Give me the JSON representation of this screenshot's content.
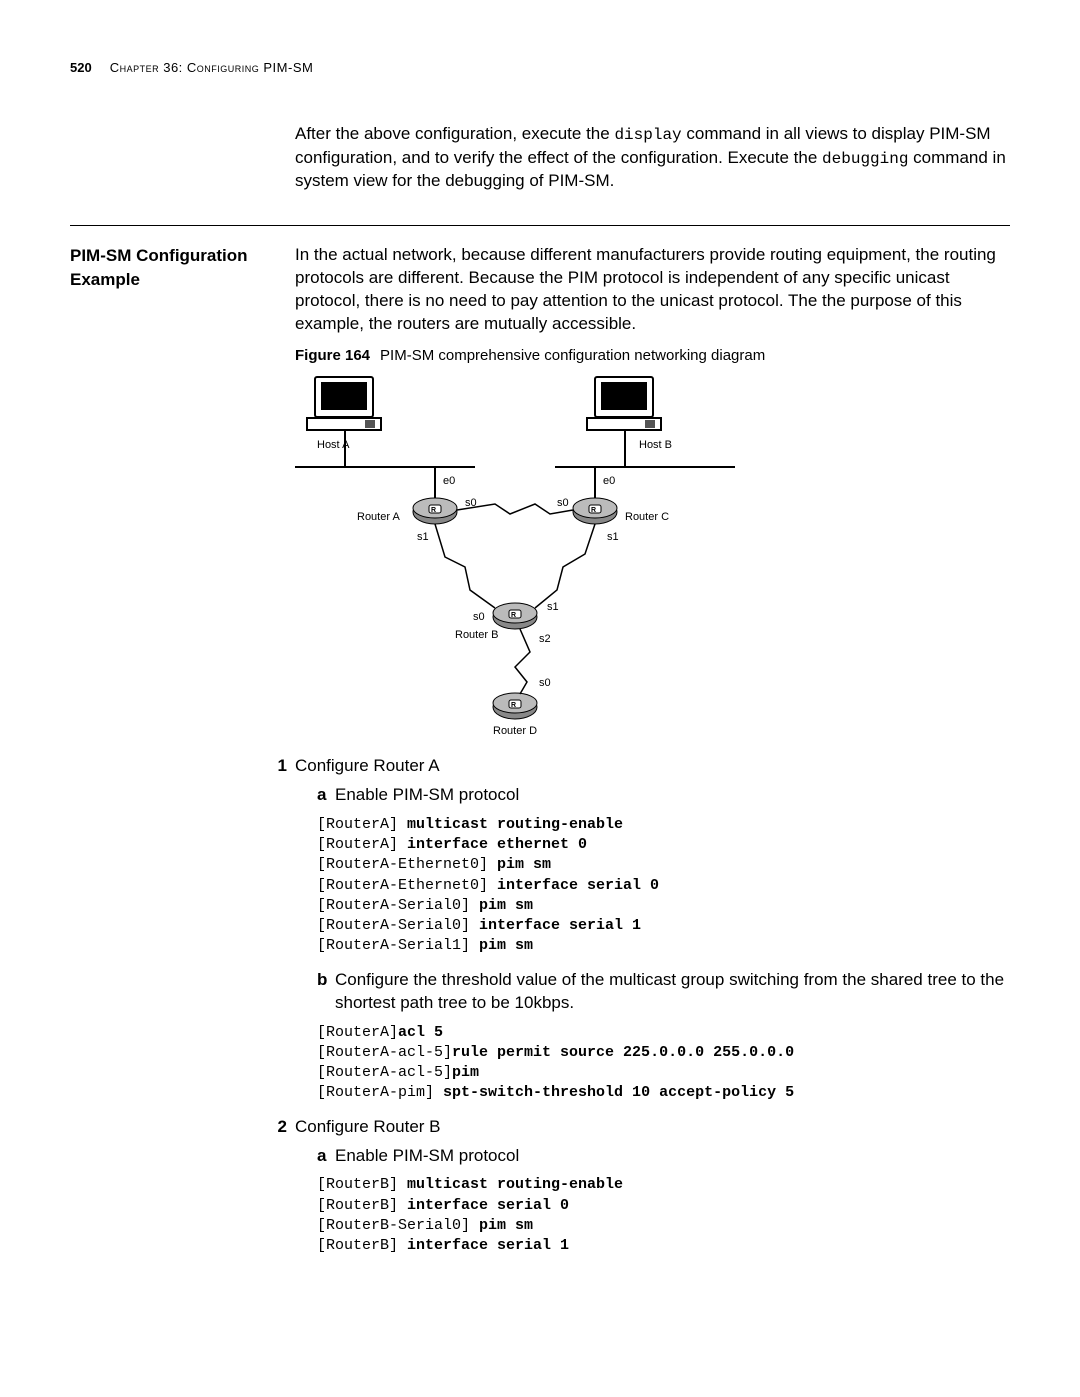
{
  "header": {
    "page_number": "520",
    "chapter_line": "Chapter 36: Configuring PIM-SM"
  },
  "intro_para": {
    "t1a": "After the above configuration, execute the ",
    "code1": "display",
    "t1b": " command in all views to display PIM-SM configuration, and to verify the effect of the configuration. Execute the ",
    "code2": "debugging",
    "t1c": " command in system view for the debugging of PIM-SM."
  },
  "section_heading": "PIM-SM Configuration Example",
  "section_para": "In the actual network, because different manufacturers provide routing equipment, the routing protocols are different. Because the PIM protocol is independent of any specific unicast protocol, there is no need to pay attention to the unicast protocol. The the purpose of this example, the routers are mutually accessible.",
  "figure": {
    "label": "Figure 164",
    "caption": "PIM-SM comprehensive configuration networking diagram",
    "labels": {
      "host_a": "Host A",
      "host_b": "Host B",
      "router_a": "Router A",
      "router_b": "Router B",
      "router_c": "Router C",
      "router_d": "Router D",
      "e0_1": "e0",
      "e0_2": "e0",
      "s0_1": "s0",
      "s0_2": "s0",
      "s1_1": "s1",
      "s1_2": "s1",
      "s0_3": "s0",
      "s1_3": "s1",
      "s2": "s2",
      "s0_4": "s0"
    }
  },
  "steps": {
    "step1": {
      "num": "1",
      "title": "Configure Router A",
      "sub_a": {
        "letter": "a",
        "text": "Enable PIM-SM protocol",
        "code_lines": [
          {
            "p": "[RouterA] ",
            "b": "multicast routing-enable"
          },
          {
            "p": "[RouterA] ",
            "b": "interface ethernet 0"
          },
          {
            "p": "[RouterA-Ethernet0] ",
            "b": "pim sm"
          },
          {
            "p": "[RouterA-Ethernet0] ",
            "b": "interface serial 0"
          },
          {
            "p": "[RouterA-Serial0] ",
            "b": "pim sm"
          },
          {
            "p": "[RouterA-Serial0] ",
            "b": "interface serial 1"
          },
          {
            "p": "[RouterA-Serial1] ",
            "b": "pim sm"
          }
        ]
      },
      "sub_b": {
        "letter": "b",
        "text": "Configure the threshold value of the multicast group switching from the shared tree to the shortest path tree to be 10kbps.",
        "code_lines": [
          {
            "p": "[RouterA]",
            "b": "acl 5"
          },
          {
            "p": "[RouterA-acl-5]",
            "b": "rule permit source 225.0.0.0 255.0.0.0"
          },
          {
            "p": "[RouterA-acl-5]",
            "b": "pim"
          },
          {
            "p": "[RouterA-pim] ",
            "b": "spt-switch-threshold 10 accept-policy 5"
          }
        ]
      }
    },
    "step2": {
      "num": "2",
      "title": "Configure Router B",
      "sub_a": {
        "letter": "a",
        "text": "Enable PIM-SM protocol",
        "code_lines": [
          {
            "p": "[RouterB] ",
            "b": "multicast routing-enable"
          },
          {
            "p": "[RouterB] ",
            "b": "interface serial 0"
          },
          {
            "p": "[RouterB-Serial0] ",
            "b": "pim sm"
          },
          {
            "p": "[RouterB] ",
            "b": "interface serial 1"
          }
        ]
      }
    }
  }
}
